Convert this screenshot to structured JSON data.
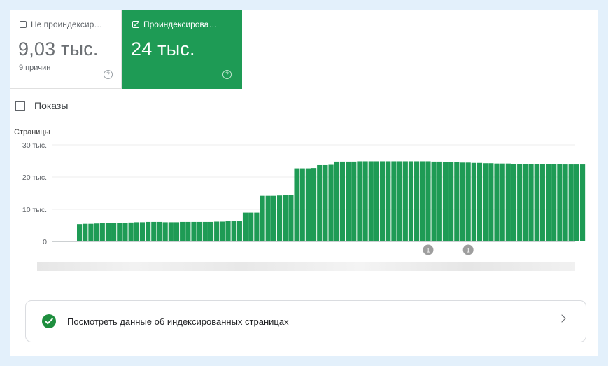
{
  "tabs": [
    {
      "label": "Не проиндексир…",
      "value": "9,03 тыс.",
      "sub": "9 причин",
      "checked": false
    },
    {
      "label": "Проиндексирова…",
      "value": "24 тыс.",
      "sub": "",
      "checked": true
    }
  ],
  "impressions_label": "Показы",
  "help_glyph": "?",
  "chart_data": {
    "type": "bar",
    "ylabel": "Страницы",
    "ylim": [
      0,
      30000
    ],
    "yticks": [
      0,
      10000,
      20000,
      30000
    ],
    "ytick_labels": [
      "0",
      "10 тыс.",
      "20 тыс.",
      "30 тыс."
    ],
    "color": "#1e9b55",
    "values": [
      5400,
      5500,
      5500,
      5600,
      5700,
      5700,
      5700,
      5800,
      5800,
      5900,
      6000,
      6000,
      6100,
      6100,
      6100,
      6000,
      6000,
      6000,
      6100,
      6100,
      6100,
      6100,
      6100,
      6100,
      6200,
      6200,
      6300,
      6300,
      6300,
      9000,
      9000,
      9000,
      14200,
      14200,
      14200,
      14300,
      14400,
      14500,
      22700,
      22700,
      22700,
      22800,
      23700,
      23700,
      23800,
      24800,
      24800,
      24800,
      24800,
      24900,
      24900,
      24900,
      24900,
      24900,
      24900,
      24900,
      24900,
      24900,
      24900,
      24900,
      24900,
      24900,
      24800,
      24800,
      24700,
      24700,
      24600,
      24500,
      24500,
      24400,
      24400,
      24300,
      24300,
      24200,
      24200,
      24200,
      24100,
      24100,
      24100,
      24100,
      24000,
      24000,
      24000,
      24000,
      24000,
      23900,
      23900,
      23900,
      23900
    ],
    "annotations": [
      {
        "index": 61,
        "label": "1"
      },
      {
        "index": 68,
        "label": "1"
      }
    ]
  },
  "link": {
    "text": "Посмотреть данные об индексированных страницах"
  },
  "colors": {
    "accent": "#1e9b55",
    "background": "#e3f0fb"
  }
}
